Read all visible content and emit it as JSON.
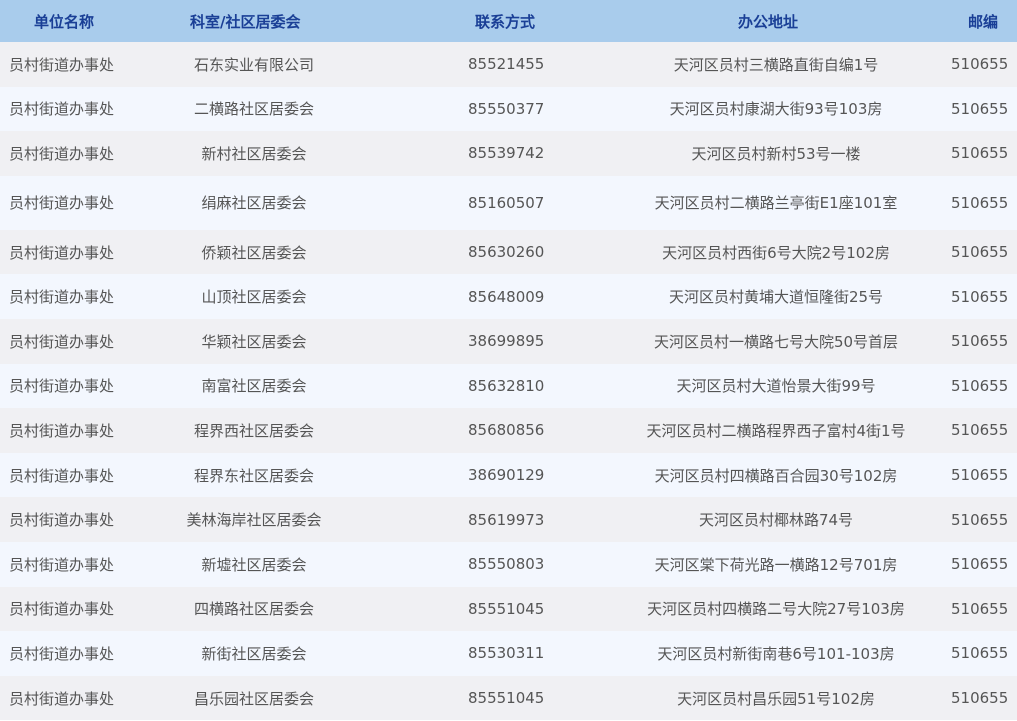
{
  "table": {
    "headers": [
      "单位名称",
      "科室/社区居委会",
      "联系方式",
      "办公地址",
      "邮编"
    ],
    "rows": [
      {
        "unit": "员村街道办事处",
        "dept": "石东实业有限公司",
        "phone": "85521455",
        "address": "天河区员村三横路直街自编1号",
        "zip": "510655"
      },
      {
        "unit": "员村街道办事处",
        "dept": "二横路社区居委会",
        "phone": "85550377",
        "address": "天河区员村康湖大街93号103房",
        "zip": "510655"
      },
      {
        "unit": "员村街道办事处",
        "dept": "新村社区居委会",
        "phone": "85539742",
        "address": "天河区员村新村53号一楼",
        "zip": "510655"
      },
      {
        "unit": "员村街道办事处",
        "dept": "绢麻社区居委会",
        "phone": "85160507",
        "address": "天河区员村二横路兰亭街E1座101室",
        "zip": "510655"
      },
      {
        "unit": "员村街道办事处",
        "dept": "侨颖社区居委会",
        "phone": "85630260",
        "address": "天河区员村西街6号大院2号102房",
        "zip": "510655"
      },
      {
        "unit": "员村街道办事处",
        "dept": "山顶社区居委会",
        "phone": "85648009",
        "address": "天河区员村黄埔大道恒隆街25号",
        "zip": "510655"
      },
      {
        "unit": "员村街道办事处",
        "dept": "华颖社区居委会",
        "phone": "38699895",
        "address": "天河区员村一横路七号大院50号首层",
        "zip": "510655"
      },
      {
        "unit": "员村街道办事处",
        "dept": "南富社区居委会",
        "phone": "85632810",
        "address": "天河区员村大道怡景大街99号",
        "zip": "510655"
      },
      {
        "unit": "员村街道办事处",
        "dept": "程界西社区居委会",
        "phone": "85680856",
        "address": "天河区员村二横路程界西子富村4街1号",
        "zip": "510655"
      },
      {
        "unit": "员村街道办事处",
        "dept": "程界东社区居委会",
        "phone": "38690129",
        "address": "天河区员村四横路百合园30号102房",
        "zip": "510655"
      },
      {
        "unit": "员村街道办事处",
        "dept": "美林海岸社区居委会",
        "phone": "85619973",
        "address": "天河区员村椰林路74号",
        "zip": "510655"
      },
      {
        "unit": "员村街道办事处",
        "dept": "新墟社区居委会",
        "phone": "85550803",
        "address": "天河区棠下荷光路一横路12号701房",
        "zip": "510655"
      },
      {
        "unit": "员村街道办事处",
        "dept": "四横路社区居委会",
        "phone": "85551045",
        "address": "天河区员村四横路二号大院27号103房",
        "zip": "510655"
      },
      {
        "unit": "员村街道办事处",
        "dept": "新街社区居委会",
        "phone": "85530311",
        "address": "天河区员村新街南巷6号101-103房",
        "zip": "510655"
      },
      {
        "unit": "员村街道办事处",
        "dept": "昌乐园社区居委会",
        "phone": "85551045",
        "address": "天河区员村昌乐园51号102房",
        "zip": "510655"
      }
    ]
  },
  "colors": {
    "header_bg": "#a9ccec",
    "header_text": "#1a3f96",
    "row_odd": "#f0f0f3",
    "row_even": "#f3f7fe",
    "cell_text": "#555555"
  }
}
